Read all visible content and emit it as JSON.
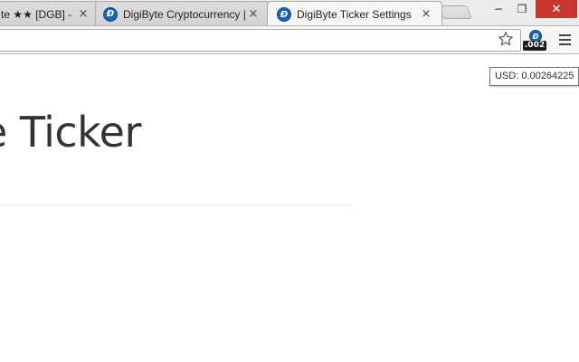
{
  "tabs": [
    {
      "title": "te ★★ [DGB] -",
      "close": "×",
      "icon": "digibyte-icon",
      "active": false
    },
    {
      "title": "DigiByte Cryptocurrency |",
      "close": "×",
      "icon": "digibyte-icon",
      "active": false
    },
    {
      "title": "DigiByte Ticker Settings",
      "close": "×",
      "icon": "digibyte-icon",
      "active": true
    }
  ],
  "window_controls": {
    "minimize": "−",
    "restore": "❐",
    "close": "✕"
  },
  "toolbar": {
    "star_icon": "bookmark-star-icon",
    "extension_badge": ".002",
    "menu_icon": "hamburger-menu-icon"
  },
  "tooltip": {
    "text": "USD: 0.00264225"
  },
  "page": {
    "heading": "e Ticker"
  },
  "colors": {
    "digibyte_blue": "#1764b5",
    "close_red": "#c7372f"
  }
}
